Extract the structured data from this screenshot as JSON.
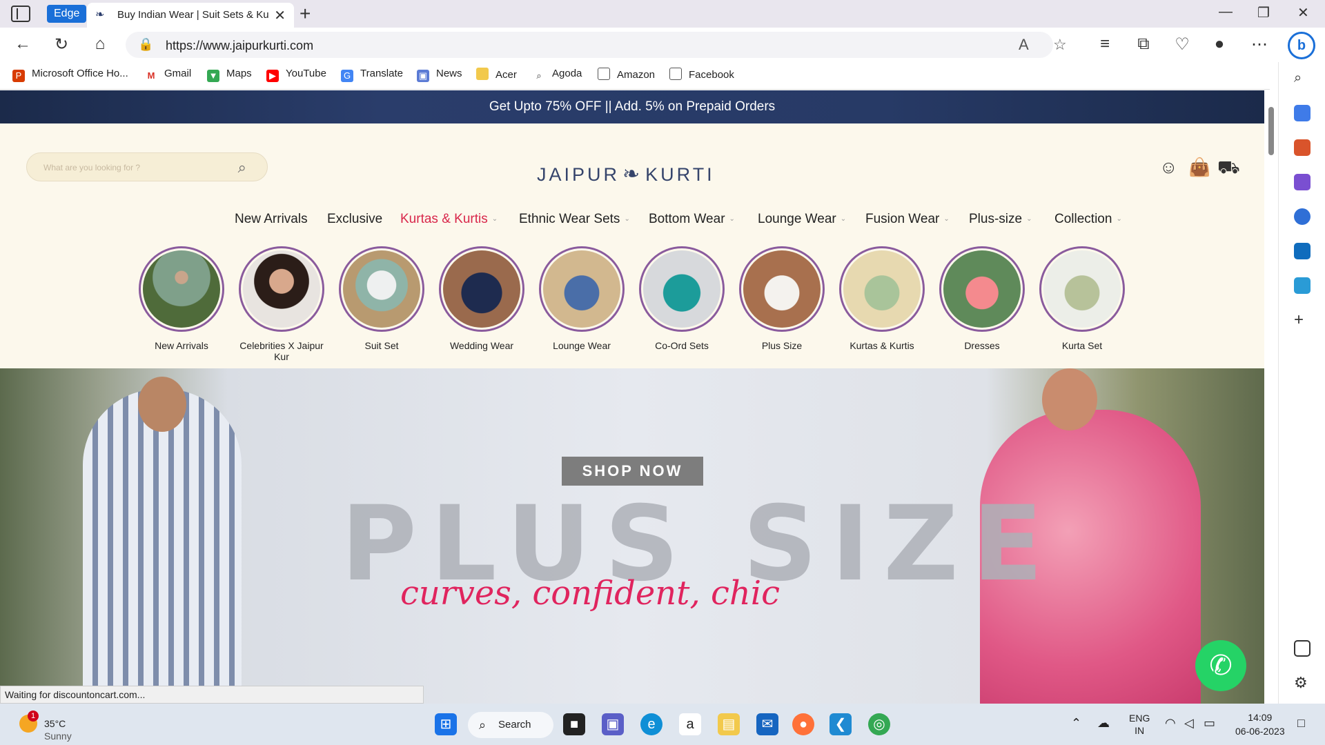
{
  "browser": {
    "edge_label": "Edge",
    "tab_title": "Buy Indian Wear | Suit Sets & Kur",
    "url": "https://www.jaipurkurti.com",
    "bookmarks": [
      "Microsoft Office Ho...",
      "Gmail",
      "Maps",
      "YouTube",
      "Translate",
      "News",
      "Acer",
      "Agoda",
      "Amazon",
      "Facebook"
    ],
    "status_text": "Waiting for discountoncart.com..."
  },
  "site": {
    "promo": "Get Upto 75% OFF || Add. 5% on Prepaid Orders",
    "search_placeholder": "What are you looking for ?",
    "logo_left": "JAIPUR",
    "logo_right": "KURTI",
    "menu": [
      "New Arrivals",
      "Exclusive",
      "Kurtas & Kurtis",
      "Ethnic Wear Sets",
      "Bottom Wear",
      "Lounge Wear",
      "Fusion Wear",
      "Plus-size",
      "Collection"
    ],
    "categories": [
      "New Arrivals",
      "Celebrities X Jaipur Kur",
      "Suit Set",
      "Wedding Wear",
      "Lounge Wear",
      "Co-Ord Sets",
      "Plus Size",
      "Kurtas & Kurtis",
      "Dresses",
      "Kurta Set"
    ],
    "hero": {
      "headline": "PLUS SIZE",
      "tagline": "curves, confident, chic",
      "cta": "SHOP NOW"
    }
  },
  "taskbar": {
    "temp": "35°C",
    "weather": "Sunny",
    "weather_badge": "1",
    "search": "Search",
    "lang_top": "ENG",
    "lang_bottom": "IN",
    "time": "14:09",
    "date": "06-06-2023"
  },
  "colors": {
    "accent_menu": "#d8264a",
    "promo_bg": "#1b2a4a",
    "page_bg": "#fcf8ec",
    "ring": "#8a5b9d"
  }
}
